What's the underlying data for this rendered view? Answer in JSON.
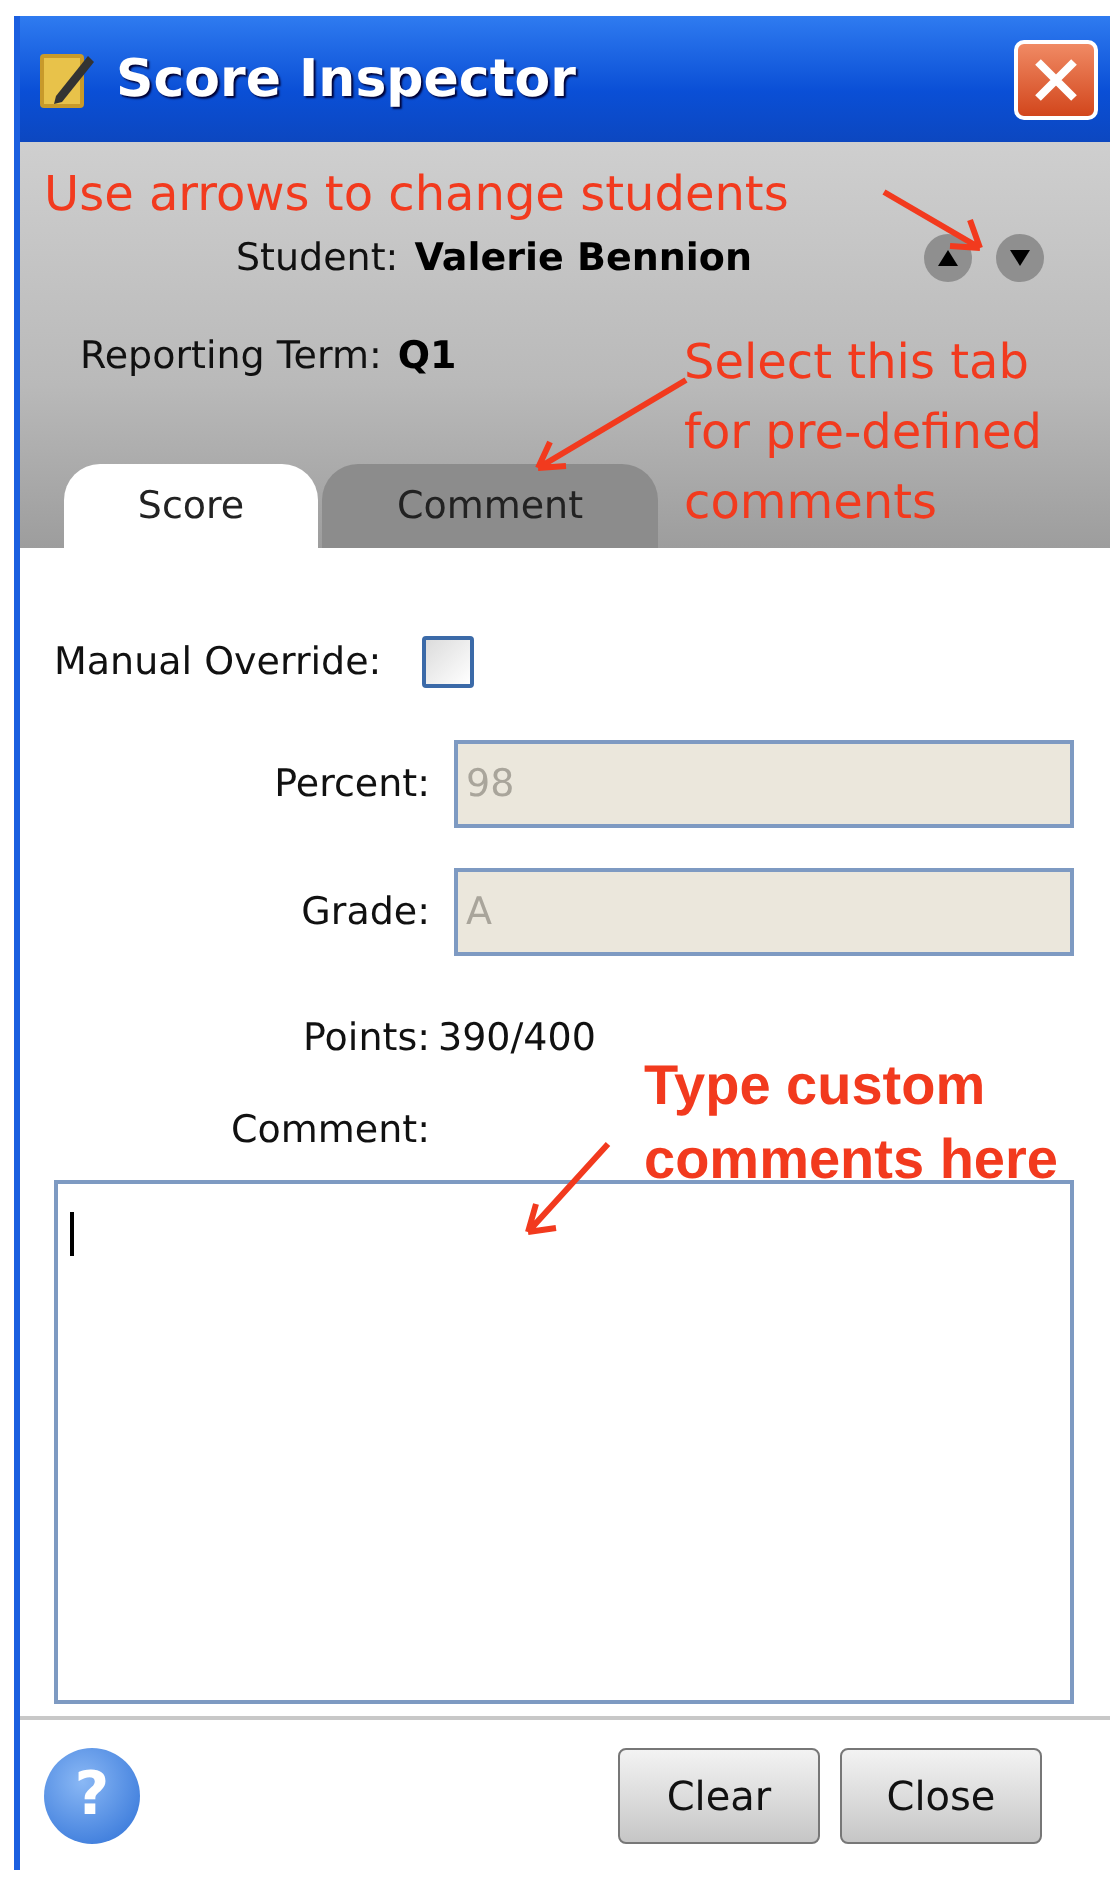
{
  "window": {
    "title": "Score Inspector"
  },
  "student": {
    "label": "Student:",
    "name": "Valerie Bennion"
  },
  "navigation": [
    {
      "kind": "up"
    },
    {
      "kind": "down"
    }
  ],
  "reporting_term": {
    "label": "Reporting Term:",
    "value": "Q1"
  },
  "tabs": [
    {
      "label": "Score",
      "selected": true
    },
    {
      "label": "Comment",
      "selected": false
    }
  ],
  "manual_override": {
    "label": "Manual Override:",
    "checked": false
  },
  "fields": [
    {
      "label": "Percent:",
      "value": "98",
      "disabled": true
    },
    {
      "label": "Grade:",
      "value": "A",
      "disabled": true
    }
  ],
  "points": {
    "label": "Points:",
    "value": "390/400"
  },
  "comment": {
    "label": "Comment:",
    "focused": true
  },
  "help": {
    "text": "?"
  },
  "buttons": [
    "Clear",
    "Close"
  ],
  "annotations": [
    {
      "kind": "plain",
      "lines": [
        "Use arrows to change students"
      ]
    },
    {
      "kind": "plain",
      "lines": [
        "Select this tab",
        "for pre-defined",
        "comments"
      ]
    },
    {
      "kind": "bold",
      "lines": [
        "Type custom",
        "comments here"
      ]
    }
  ]
}
